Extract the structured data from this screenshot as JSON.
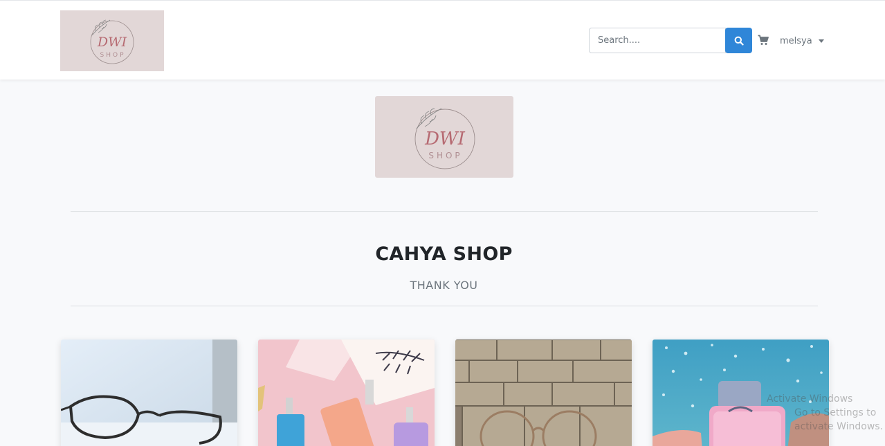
{
  "header": {
    "brand_logo_text": "DWI",
    "brand_logo_subtext": "SHOP",
    "search": {
      "placeholder": "Search....",
      "value": ""
    },
    "search_button_icon": "search-icon",
    "cart_icon": "cart-icon",
    "user_menu": {
      "label": "melsya",
      "icon": "caret-down-icon"
    }
  },
  "hero": {
    "logo_text": "DWI",
    "logo_subtext": "SHOP",
    "title": "CAHYA SHOP",
    "subtitle": "THANK YOU"
  },
  "products": [
    {
      "image": "eyeglasses-photo"
    },
    {
      "image": "perfume-bottles-photo"
    },
    {
      "image": "eyeglasses-on-stone-wall-photo"
    },
    {
      "image": "pink-perfume-by-sea-photo"
    }
  ],
  "watermark": {
    "line1": "Activate Windows",
    "line2": "Go to Settings to activate Windows."
  },
  "colors": {
    "primary": "#2f86d8",
    "logo_bg": "#e2d7d7",
    "page_bg": "#f8f9fb"
  }
}
